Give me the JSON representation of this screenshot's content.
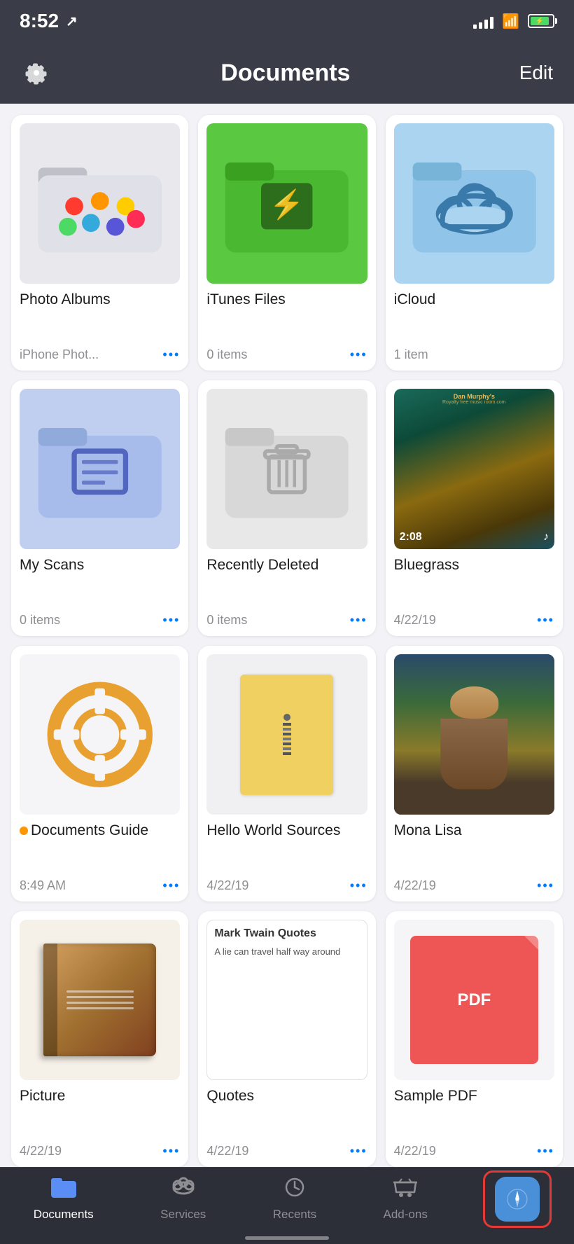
{
  "statusBar": {
    "time": "8:52",
    "locationIcon": "↗",
    "signalBars": [
      4,
      6,
      9,
      12,
      15
    ],
    "batteryLevel": 85
  },
  "navBar": {
    "title": "Documents",
    "editLabel": "Edit"
  },
  "grid": {
    "items": [
      {
        "id": "photo-albums",
        "name": "Photo Albums",
        "meta": "iPhone Phot...",
        "showDots": true,
        "type": "folder-photo"
      },
      {
        "id": "itunes-files",
        "name": "iTunes Files",
        "meta": "0 items",
        "showDots": true,
        "type": "folder-green"
      },
      {
        "id": "icloud",
        "name": "iCloud",
        "meta": "1 item",
        "showDots": false,
        "type": "folder-cloud"
      },
      {
        "id": "my-scans",
        "name": "My Scans",
        "meta": "0 items",
        "showDots": true,
        "type": "folder-scans"
      },
      {
        "id": "recently-deleted",
        "name": "Recently Deleted",
        "meta": "0 items",
        "showDots": true,
        "type": "folder-trash"
      },
      {
        "id": "bluegrass",
        "name": "Bluegrass",
        "meta": "4/22/19",
        "showDots": true,
        "type": "music",
        "duration": "2:08",
        "site": "Dan Murphy's Royalty free music room.com"
      },
      {
        "id": "documents-guide",
        "name": "Documents Guide",
        "meta": "8:49 AM",
        "showDots": true,
        "type": "lifesaver",
        "hasIndicator": true
      },
      {
        "id": "hello-world-sources",
        "name": "Hello World Sources",
        "meta": "4/22/19",
        "showDots": true,
        "type": "zip"
      },
      {
        "id": "mona-lisa",
        "name": "Mona Lisa",
        "meta": "4/22/19",
        "showDots": true,
        "type": "mona"
      },
      {
        "id": "picture",
        "name": "Picture",
        "meta": "4/22/19",
        "showDots": true,
        "type": "book"
      },
      {
        "id": "quotes",
        "name": "Quotes",
        "meta": "4/22/19",
        "showDots": true,
        "type": "quotes",
        "quotesTitle": "Mark Twain Quotes",
        "quotesText": "A lie can travel half way around"
      },
      {
        "id": "sample-pdf",
        "name": "Sample PDF",
        "meta": "4/22/19",
        "showDots": true,
        "type": "pdf"
      }
    ]
  },
  "tabBar": {
    "tabs": [
      {
        "id": "documents",
        "label": "Documents",
        "icon": "folder",
        "active": true
      },
      {
        "id": "services",
        "label": "Services",
        "icon": "cloud",
        "active": false
      },
      {
        "id": "recents",
        "label": "Recents",
        "icon": "clock",
        "active": false
      },
      {
        "id": "add-ons",
        "label": "Add-ons",
        "icon": "cart",
        "active": false
      },
      {
        "id": "browser",
        "label": "Browser",
        "icon": "compass",
        "active": false,
        "highlighted": true
      }
    ]
  }
}
